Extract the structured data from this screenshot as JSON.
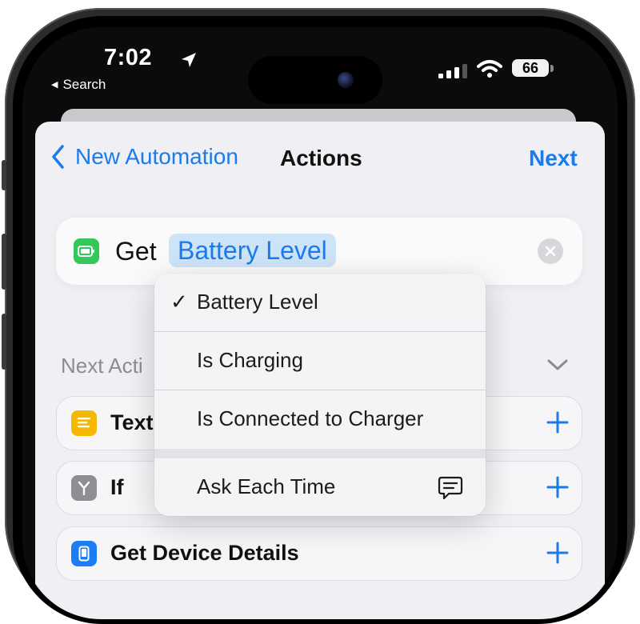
{
  "status_bar": {
    "time": "7:02",
    "back_label": "Search",
    "battery": "66"
  },
  "nav": {
    "back_label": "New Automation",
    "title": "Actions",
    "next_label": "Next"
  },
  "action_card": {
    "verb": "Get",
    "parameter": "Battery Level",
    "icon": "battery-icon",
    "accent_color": "#34c759"
  },
  "next_actions": {
    "header": "Next Acti",
    "items": [
      {
        "label": "Text",
        "icon": "text-icon",
        "color": "#f5b800"
      },
      {
        "label": "If",
        "icon": "if-branch-icon",
        "color": "#8e8e93"
      },
      {
        "label": "Get Device Details",
        "icon": "device-icon",
        "color": "#1e7cf2"
      }
    ]
  },
  "menu": {
    "options": [
      {
        "label": "Battery Level",
        "checked": true
      },
      {
        "label": "Is Charging",
        "checked": false
      },
      {
        "label": "Is Connected to Charger",
        "checked": false
      }
    ],
    "check_mark": "✓",
    "ask_each_time": "Ask Each Time"
  },
  "colors": {
    "accent": "#1b7bea",
    "parameter_bg": "#cde3f8",
    "sheet_bg": "#efeff4"
  }
}
